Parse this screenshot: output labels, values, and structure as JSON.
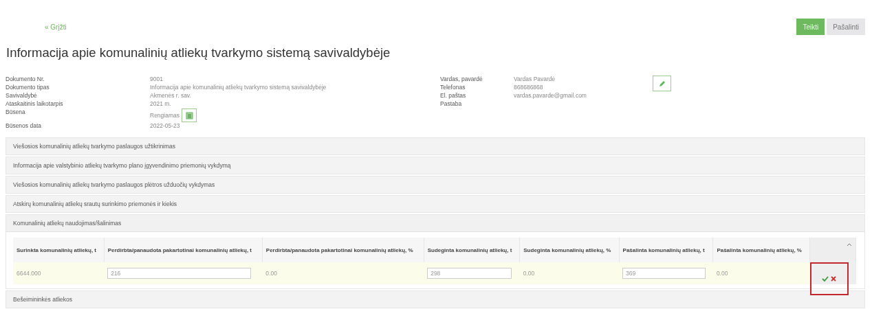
{
  "back_link": "« Grįžti",
  "actions": [
    {
      "label": "Teikti",
      "kind": "primary"
    },
    {
      "label": "Pašalinti",
      "kind": "secondary"
    }
  ],
  "title": "Informacija apie komunalinių atliekų tvarkymo sistemą savivaldybėje",
  "document_fields": [
    {
      "label": "Dokumento Nr.",
      "value": "9001"
    },
    {
      "label": "Dokumento tipas",
      "value": "Informacija apie komunalinių atliekų tvarkymo sistemą savivaldybėje"
    },
    {
      "label": "Savivaldybė",
      "value": "Akmenės r. sav."
    },
    {
      "label": "Ataskaitinis laikotarpis",
      "value": "2021 m."
    },
    {
      "label": "Būsena",
      "value": "Rengiamas",
      "kind": "status"
    },
    {
      "label": "Būsenos data",
      "value": "2022-05-23"
    }
  ],
  "contact_fields": [
    {
      "label": "Vardas, pavardė",
      "value": "Vardas Pavardė"
    },
    {
      "label": "Telefonas",
      "value": "868686868"
    },
    {
      "label": "El. paštas",
      "value": "vardas.pavarde@gmail.com"
    },
    {
      "label": "Pastaba"
    }
  ],
  "sections": [
    {
      "title": "Viešosios komunalinių atliekų tvarkymo paslaugos užtikrinimas",
      "expanded": false
    },
    {
      "title": "Informacija apie valstybinio atliekų tvarkymo plano įgyvendinimo priemonių vykdymą",
      "expanded": false
    },
    {
      "title": "Viešosios komunalinių atliekų tvarkymo paslaugos plėtros užduočių vykdymas",
      "expanded": false
    },
    {
      "title": "Atskirų komunalinių atliekų srautų surinkimo priemonės ir kiekis",
      "expanded": false
    },
    {
      "title": "Komunalinių atliekų naudojimas/šalinimas",
      "expanded": true,
      "table": {
        "columns": [
          "Surinkta komunalinių atliekų, t",
          "Perdirbta/panaudota pakartotinai komunalinių atliekų, t",
          "Perdirbta/panaudota pakartotinai komunalinių atliekų, %",
          "Sudeginta komunalinių atliekų, t",
          "Sudeginta komunalinių atliekų, %",
          "Pašalinta komunalinių atliekų, t",
          "Pašalinta komunalinių atliekų, %"
        ],
        "rows": [
          {
            "editing": true,
            "actions_highlighted": true,
            "cells": [
              {
                "kind": "text",
                "value": "6644.000"
              },
              {
                "kind": "input",
                "value": "216"
              },
              {
                "kind": "text",
                "value": "0.00"
              },
              {
                "kind": "input",
                "value": "298"
              },
              {
                "kind": "text",
                "value": "0.00"
              },
              {
                "kind": "input",
                "value": "369"
              },
              {
                "kind": "text",
                "value": "0.00"
              }
            ]
          }
        ]
      }
    },
    {
      "title": "Bešeimininkės atliekos",
      "expanded": false
    }
  ]
}
